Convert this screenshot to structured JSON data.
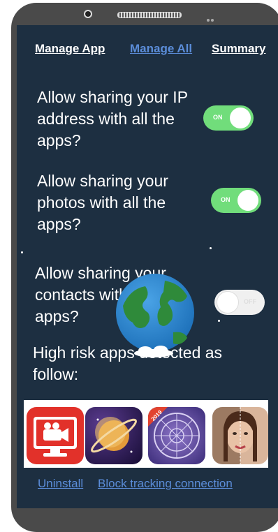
{
  "tabs": [
    {
      "label": "Manage App",
      "active": false
    },
    {
      "label": "Manage All",
      "active": true
    },
    {
      "label": "Summary",
      "active": false
    }
  ],
  "settings": [
    {
      "question": "Allow sharing your IP address with all the apps?",
      "toggle_label": "ON",
      "state": "on"
    },
    {
      "question": "Allow sharing your photos with all the apps?",
      "toggle_label": "ON",
      "state": "on"
    },
    {
      "question": "Allow sharing your contacts with all apps?",
      "toggle_label": "OFF",
      "state": "off"
    }
  ],
  "risk_heading": "High risk apps detected as follow:",
  "risk_apps": [
    {
      "icon": "video-camera-icon"
    },
    {
      "icon": "planet-icon"
    },
    {
      "icon": "zodiac-wheel-icon",
      "badge": "2019"
    },
    {
      "icon": "face-portrait-icon"
    }
  ],
  "links": {
    "uninstall": "Uninstall",
    "block": "Block tracking connection"
  },
  "colors": {
    "screen_bg": "#1d2f41",
    "toggle_on": "#71dd7b",
    "link": "#5b8dd9"
  }
}
